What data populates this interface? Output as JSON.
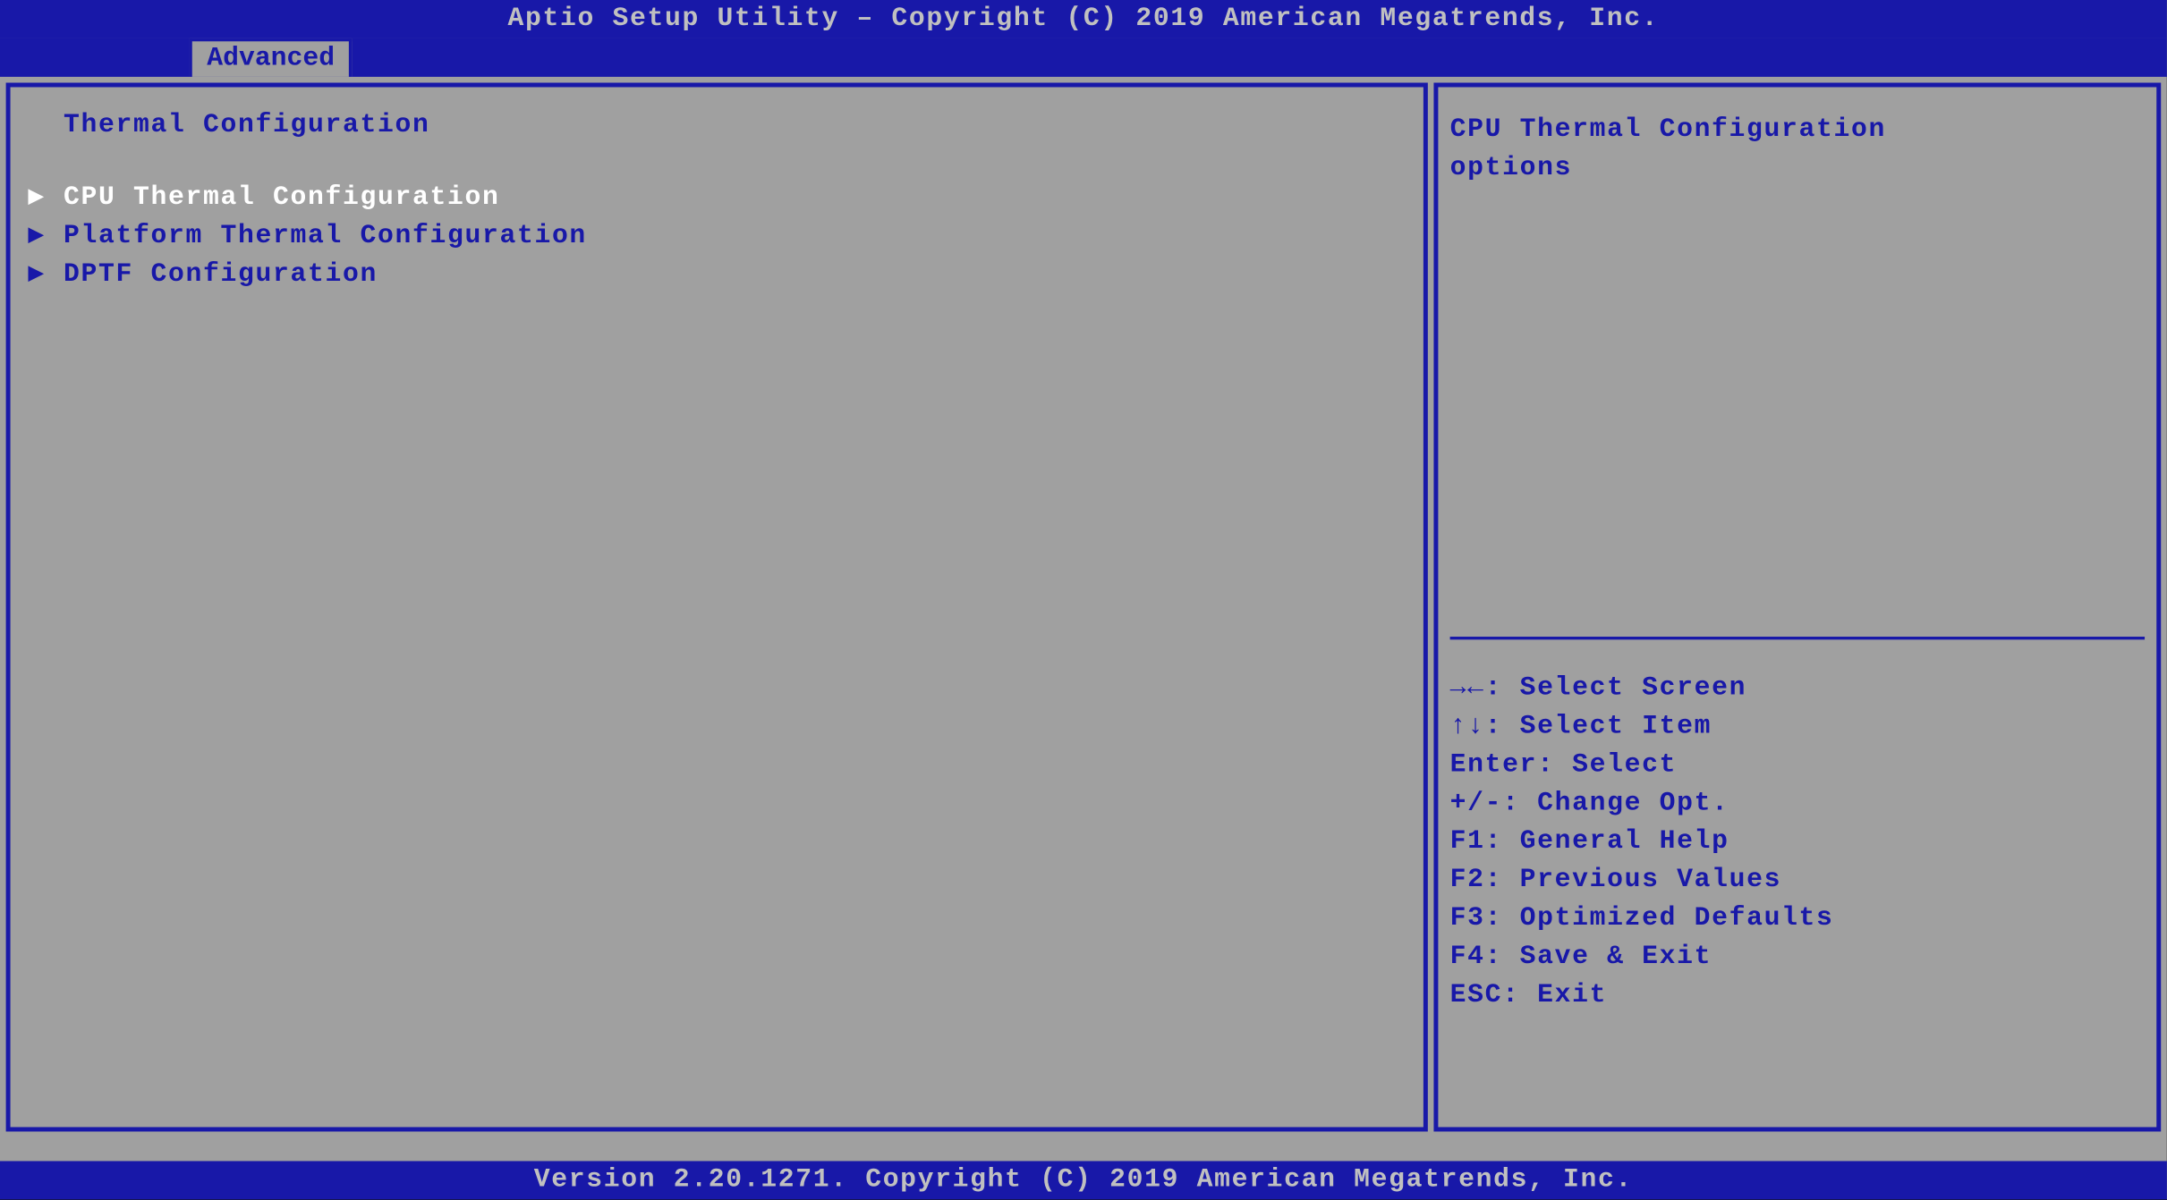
{
  "header": {
    "title": "Aptio Setup Utility – Copyright (C) 2019 American Megatrends, Inc."
  },
  "tab": {
    "label": "Advanced"
  },
  "main": {
    "section_title": "Thermal Configuration",
    "items": [
      {
        "label": "CPU Thermal Configuration",
        "selected": true
      },
      {
        "label": "Platform Thermal Configuration",
        "selected": false
      },
      {
        "label": "DPTF Configuration",
        "selected": false
      }
    ]
  },
  "help": {
    "text_line1": "CPU Thermal Configuration",
    "text_line2": "options"
  },
  "hints": [
    {
      "keys": "→←:",
      "desc": "Select Screen"
    },
    {
      "keys": "↑↓:",
      "desc": "Select Item"
    },
    {
      "keys": "Enter:",
      "desc": "Select"
    },
    {
      "keys": "+/-:",
      "desc": "Change Opt."
    },
    {
      "keys": "F1:",
      "desc": "General Help"
    },
    {
      "keys": "F2:",
      "desc": "Previous Values"
    },
    {
      "keys": "F3:",
      "desc": "Optimized Defaults"
    },
    {
      "keys": "F4:",
      "desc": "Save & Exit"
    },
    {
      "keys": "ESC:",
      "desc": "Exit"
    }
  ],
  "footer": {
    "text": "Version 2.20.1271. Copyright (C) 2019 American Megatrends, Inc."
  }
}
